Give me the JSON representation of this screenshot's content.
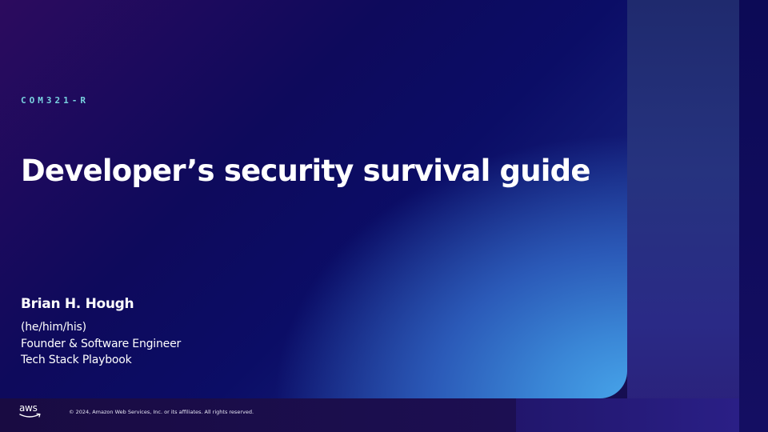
{
  "slide": {
    "session_code": "COM321-R",
    "title": "Developer’s security survival guide",
    "presenter": {
      "name": "Brian H. Hough",
      "pronouns": "(he/him/his)",
      "role": "Founder & Software Engineer",
      "company": "Tech Stack Playbook"
    }
  },
  "footer": {
    "logo_text": "aws",
    "copyright": "© 2024, Amazon Web Services, Inc. or its affiliates. All rights reserved."
  },
  "colors": {
    "session_code": "#79d3e0",
    "text": "#ffffff",
    "glow": "#47a5ea",
    "background": "#1b0f52"
  },
  "icons": {
    "logo": "aws-logo"
  }
}
